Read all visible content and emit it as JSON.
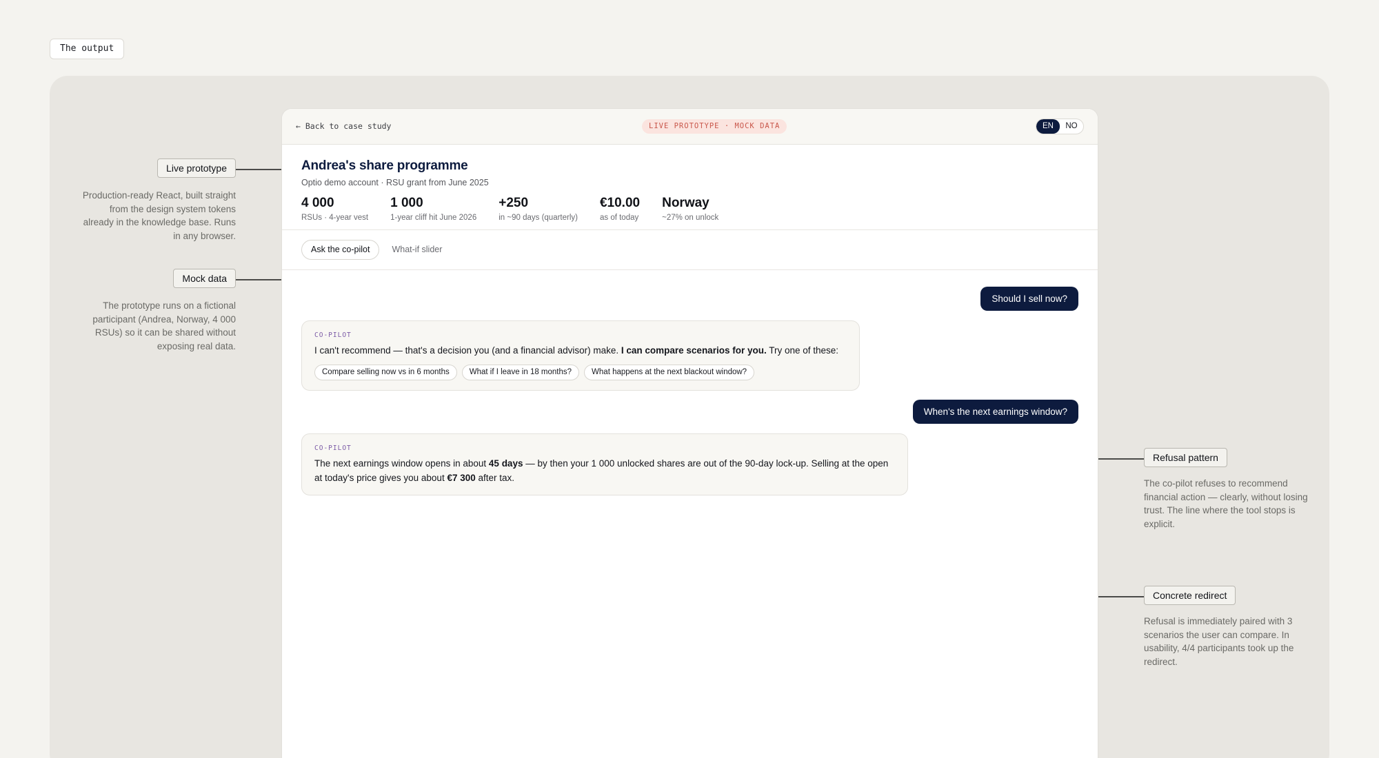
{
  "section_tag": "The output",
  "annotations": {
    "live_prototype": {
      "title": "Live prototype",
      "text": "Production-ready React, built straight from the design system tokens already in the knowledge base. Runs in any browser."
    },
    "mock_data": {
      "title": "Mock data",
      "text": "The prototype runs on a fictional participant (Andrea, Norway, 4 000 RSUs) so it can be shared without exposing real data."
    },
    "refusal_pattern": {
      "title": "Refusal pattern",
      "text": "The co-pilot refuses to recommend financial action — clearly, without losing trust. The line where the tool stops is explicit."
    },
    "concrete_redirect": {
      "title": "Concrete redirect",
      "text": "Refusal is immediately paired with 3 scenarios the user can compare. In usability, 4/4 participants took up the redirect."
    }
  },
  "app": {
    "back_link": "← Back to case study",
    "badge": "LIVE PROTOTYPE · MOCK DATA",
    "lang": {
      "en": "EN",
      "no": "NO",
      "active": "EN"
    },
    "title": "Andrea's share programme",
    "subtitle": "Optio demo account · RSU grant from June 2025",
    "stats": [
      {
        "value": "4 000",
        "label": "RSUs · 4-year vest"
      },
      {
        "value": "1 000",
        "label": "1-year cliff hit June 2026"
      },
      {
        "value": "+250",
        "label": "in ~90 days (quarterly)"
      },
      {
        "value": "€10.00",
        "label": "as of today"
      },
      {
        "value": "Norway",
        "label": "~27% on unlock"
      }
    ],
    "tabs": [
      {
        "label": "Ask the co-pilot",
        "active": true
      },
      {
        "label": "What-if slider",
        "active": false
      }
    ],
    "chat": {
      "user_1": "Should I sell now?",
      "bot_1": {
        "label": "CO-PILOT",
        "text_a": "I can't recommend — that's a decision you (and a financial advisor) make. ",
        "text_bold": "I can compare scenarios for you.",
        "text_b": " Try one of these:",
        "chips": [
          "Compare selling now vs in 6 months",
          "What if I leave in 18 months?",
          "What happens at the next blackout window?"
        ]
      },
      "user_2": "When's the next earnings window?",
      "bot_2": {
        "label": "CO-PILOT",
        "text_a": "The next earnings window opens in about ",
        "bold_1": "45 days",
        "text_b": " — by then your 1 000 unlocked shares are out of the 90-day lock-up. Selling at the open at today's price gives you about ",
        "bold_2": "€7 300",
        "text_c": " after tax."
      }
    }
  },
  "colors": {
    "navy": "#0d1b3e",
    "badge_bg": "#fbe4df",
    "badge_text": "#c8564a",
    "copilot_label": "#7b5aa6"
  }
}
